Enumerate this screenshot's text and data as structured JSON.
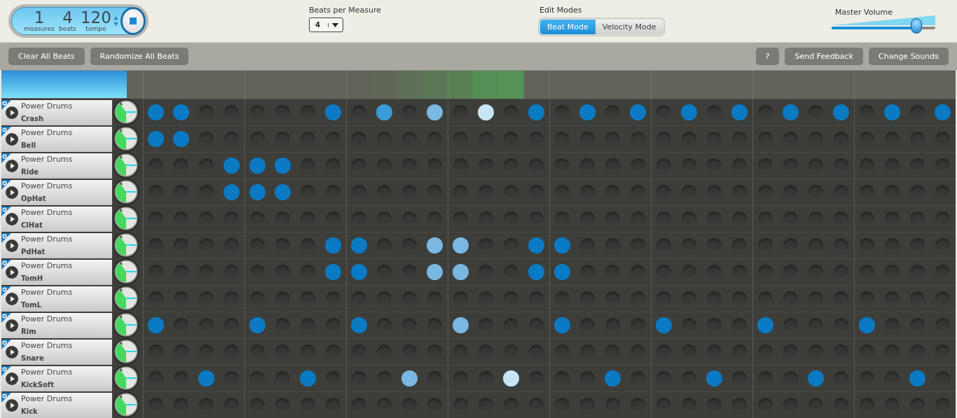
{
  "transport": {
    "measures": {
      "value": "1",
      "label": "measures"
    },
    "beats": {
      "value": "4",
      "label": "beats"
    },
    "tempo": {
      "value": "120",
      "label": "tempo"
    }
  },
  "beats_per_measure": {
    "label": "Beats per Measure",
    "value": "4"
  },
  "edit_modes": {
    "label": "Edit Modes",
    "tabs": [
      {
        "label": "Beat Mode",
        "selected": true
      },
      {
        "label": "Velocity Mode",
        "selected": false
      }
    ]
  },
  "master_volume": {
    "label": "Master Volume",
    "level": 0.82
  },
  "toolbar": {
    "left": [
      "Clear All Beats",
      "Randomize All Beats"
    ],
    "right": [
      "?",
      "Send Feedback",
      "Change Sounds"
    ]
  },
  "timeline": [
    {
      "color": "#63625b"
    },
    {
      "color": "#63625b"
    },
    {
      "color": "#63625b"
    },
    {
      "color": "#63625b"
    },
    {
      "color": "#63625b"
    },
    {
      "color": "#63625b"
    },
    {
      "color": "#63625b"
    },
    {
      "color": "#63625b"
    },
    {
      "color": "#63625b"
    },
    {
      "color": "#606759"
    },
    {
      "color": "#5d7057"
    },
    {
      "color": "#5b7856"
    },
    {
      "color": "#598055"
    },
    {
      "color": "#568f55"
    },
    {
      "color": "#559255"
    },
    {
      "color": "#63625b"
    },
    {
      "color": "#63625b"
    },
    {
      "color": "#63625b"
    },
    {
      "color": "#63625b"
    },
    {
      "color": "#63625b"
    },
    {
      "color": "#63625b"
    },
    {
      "color": "#63625b"
    },
    {
      "color": "#63625b"
    },
    {
      "color": "#63625b"
    },
    {
      "color": "#63625b"
    },
    {
      "color": "#63625b"
    },
    {
      "color": "#63625b"
    },
    {
      "color": "#63625b"
    },
    {
      "color": "#63625b"
    },
    {
      "color": "#63625b"
    },
    {
      "color": "#63625b"
    },
    {
      "color": "#63625b"
    }
  ],
  "tracks": [
    {
      "kit": "Power Drums",
      "name": "Crash",
      "steps": [
        {
          "on": true,
          "color": "#0a7ac4"
        },
        {
          "on": true,
          "color": "#0a7ac4"
        },
        {
          "on": false
        },
        {
          "on": false
        },
        {
          "on": false
        },
        {
          "on": false
        },
        {
          "on": false
        },
        {
          "on": true,
          "color": "#0a7ac4"
        },
        {
          "on": false
        },
        {
          "on": true,
          "color": "#3d9ad8"
        },
        {
          "on": false
        },
        {
          "on": true,
          "color": "#7ab8e2"
        },
        {
          "on": false
        },
        {
          "on": true,
          "color": "#c8e5f5"
        },
        {
          "on": false
        },
        {
          "on": true,
          "color": "#0a7ac4"
        },
        {
          "on": false
        },
        {
          "on": true,
          "color": "#0a7ac4"
        },
        {
          "on": false
        },
        {
          "on": true,
          "color": "#0a7ac4"
        },
        {
          "on": false
        },
        {
          "on": true,
          "color": "#0a7ac4"
        },
        {
          "on": false
        },
        {
          "on": true,
          "color": "#0a7ac4"
        },
        {
          "on": false
        },
        {
          "on": true,
          "color": "#0a7ac4"
        },
        {
          "on": false
        },
        {
          "on": true,
          "color": "#0a7ac4"
        },
        {
          "on": false
        },
        {
          "on": true,
          "color": "#0a7ac4"
        },
        {
          "on": false
        },
        {
          "on": true,
          "color": "#0a7ac4"
        }
      ]
    },
    {
      "kit": "Power Drums",
      "name": "Bell",
      "steps": [
        {
          "on": true,
          "color": "#0a7ac4"
        },
        {
          "on": true,
          "color": "#0a7ac4"
        },
        {
          "on": false
        },
        {
          "on": false
        },
        {
          "on": false
        },
        {
          "on": false
        },
        {
          "on": false
        },
        {
          "on": false
        },
        {
          "on": false
        },
        {
          "on": false
        },
        {
          "on": false
        },
        {
          "on": false
        },
        {
          "on": false
        },
        {
          "on": false
        },
        {
          "on": false
        },
        {
          "on": false
        },
        {
          "on": false
        },
        {
          "on": false
        },
        {
          "on": false
        },
        {
          "on": false
        },
        {
          "on": false
        },
        {
          "on": false
        },
        {
          "on": false
        },
        {
          "on": false
        },
        {
          "on": false
        },
        {
          "on": false
        },
        {
          "on": false
        },
        {
          "on": false
        },
        {
          "on": false
        },
        {
          "on": false
        },
        {
          "on": false
        },
        {
          "on": false
        }
      ]
    },
    {
      "kit": "Power Drums",
      "name": "Ride",
      "steps": [
        {
          "on": false
        },
        {
          "on": false
        },
        {
          "on": false
        },
        {
          "on": true,
          "color": "#0a7ac4"
        },
        {
          "on": true,
          "color": "#0a7ac4"
        },
        {
          "on": true,
          "color": "#0a7ac4"
        },
        {
          "on": false
        },
        {
          "on": false
        },
        {
          "on": false
        },
        {
          "on": false
        },
        {
          "on": false
        },
        {
          "on": false
        },
        {
          "on": false
        },
        {
          "on": false
        },
        {
          "on": false
        },
        {
          "on": false
        },
        {
          "on": false
        },
        {
          "on": false
        },
        {
          "on": false
        },
        {
          "on": false
        },
        {
          "on": false
        },
        {
          "on": false
        },
        {
          "on": false
        },
        {
          "on": false
        },
        {
          "on": false
        },
        {
          "on": false
        },
        {
          "on": false
        },
        {
          "on": false
        },
        {
          "on": false
        },
        {
          "on": false
        },
        {
          "on": false
        },
        {
          "on": false
        }
      ]
    },
    {
      "kit": "Power Drums",
      "name": "OpHat",
      "steps": [
        {
          "on": false
        },
        {
          "on": false
        },
        {
          "on": false
        },
        {
          "on": true,
          "color": "#0a7ac4"
        },
        {
          "on": true,
          "color": "#0a7ac4"
        },
        {
          "on": true,
          "color": "#0a7ac4"
        },
        {
          "on": false
        },
        {
          "on": false
        },
        {
          "on": false
        },
        {
          "on": false
        },
        {
          "on": false
        },
        {
          "on": false
        },
        {
          "on": false
        },
        {
          "on": false
        },
        {
          "on": false
        },
        {
          "on": false
        },
        {
          "on": false
        },
        {
          "on": false
        },
        {
          "on": false
        },
        {
          "on": false
        },
        {
          "on": false
        },
        {
          "on": false
        },
        {
          "on": false
        },
        {
          "on": false
        },
        {
          "on": false
        },
        {
          "on": false
        },
        {
          "on": false
        },
        {
          "on": false
        },
        {
          "on": false
        },
        {
          "on": false
        },
        {
          "on": false
        },
        {
          "on": false
        }
      ]
    },
    {
      "kit": "Power Drums",
      "name": "ClHat",
      "steps": [
        {
          "on": false
        },
        {
          "on": false
        },
        {
          "on": false
        },
        {
          "on": false
        },
        {
          "on": false
        },
        {
          "on": false
        },
        {
          "on": false
        },
        {
          "on": false
        },
        {
          "on": false
        },
        {
          "on": false
        },
        {
          "on": false
        },
        {
          "on": false
        },
        {
          "on": false
        },
        {
          "on": false
        },
        {
          "on": false
        },
        {
          "on": false
        },
        {
          "on": false
        },
        {
          "on": false
        },
        {
          "on": false
        },
        {
          "on": false
        },
        {
          "on": false
        },
        {
          "on": false
        },
        {
          "on": false
        },
        {
          "on": false
        },
        {
          "on": false
        },
        {
          "on": false
        },
        {
          "on": false
        },
        {
          "on": false
        },
        {
          "on": false
        },
        {
          "on": false
        },
        {
          "on": false
        },
        {
          "on": false
        }
      ]
    },
    {
      "kit": "Power Drums",
      "name": "PdHat",
      "steps": [
        {
          "on": false
        },
        {
          "on": false
        },
        {
          "on": false
        },
        {
          "on": false
        },
        {
          "on": false
        },
        {
          "on": false
        },
        {
          "on": false
        },
        {
          "on": true,
          "color": "#0a7ac4"
        },
        {
          "on": true,
          "color": "#0a7ac4"
        },
        {
          "on": false
        },
        {
          "on": false
        },
        {
          "on": true,
          "color": "#7ab8e2"
        },
        {
          "on": true,
          "color": "#7ab8e2"
        },
        {
          "on": false
        },
        {
          "on": false
        },
        {
          "on": true,
          "color": "#0a7ac4"
        },
        {
          "on": true,
          "color": "#0a7ac4"
        },
        {
          "on": false
        },
        {
          "on": false
        },
        {
          "on": false
        },
        {
          "on": false
        },
        {
          "on": false
        },
        {
          "on": false
        },
        {
          "on": false
        },
        {
          "on": false
        },
        {
          "on": false
        },
        {
          "on": false
        },
        {
          "on": false
        },
        {
          "on": false
        },
        {
          "on": false
        },
        {
          "on": false
        },
        {
          "on": false
        }
      ]
    },
    {
      "kit": "Power Drums",
      "name": "TomH",
      "steps": [
        {
          "on": false
        },
        {
          "on": false
        },
        {
          "on": false
        },
        {
          "on": false
        },
        {
          "on": false
        },
        {
          "on": false
        },
        {
          "on": false
        },
        {
          "on": true,
          "color": "#0a7ac4"
        },
        {
          "on": true,
          "color": "#0a7ac4"
        },
        {
          "on": false
        },
        {
          "on": false
        },
        {
          "on": true,
          "color": "#7ab8e2"
        },
        {
          "on": true,
          "color": "#7ab8e2"
        },
        {
          "on": false
        },
        {
          "on": false
        },
        {
          "on": true,
          "color": "#0a7ac4"
        },
        {
          "on": true,
          "color": "#0a7ac4"
        },
        {
          "on": false
        },
        {
          "on": false
        },
        {
          "on": false
        },
        {
          "on": false
        },
        {
          "on": false
        },
        {
          "on": false
        },
        {
          "on": false
        },
        {
          "on": false
        },
        {
          "on": false
        },
        {
          "on": false
        },
        {
          "on": false
        },
        {
          "on": false
        },
        {
          "on": false
        },
        {
          "on": false
        },
        {
          "on": false
        }
      ]
    },
    {
      "kit": "Power Drums",
      "name": "TomL",
      "steps": [
        {
          "on": false
        },
        {
          "on": false
        },
        {
          "on": false
        },
        {
          "on": false
        },
        {
          "on": false
        },
        {
          "on": false
        },
        {
          "on": false
        },
        {
          "on": false
        },
        {
          "on": false
        },
        {
          "on": false
        },
        {
          "on": false
        },
        {
          "on": false
        },
        {
          "on": false
        },
        {
          "on": false
        },
        {
          "on": false
        },
        {
          "on": false
        },
        {
          "on": false
        },
        {
          "on": false
        },
        {
          "on": false
        },
        {
          "on": false
        },
        {
          "on": false
        },
        {
          "on": false
        },
        {
          "on": false
        },
        {
          "on": false
        },
        {
          "on": false
        },
        {
          "on": false
        },
        {
          "on": false
        },
        {
          "on": false
        },
        {
          "on": false
        },
        {
          "on": false
        },
        {
          "on": false
        },
        {
          "on": false
        }
      ]
    },
    {
      "kit": "Power Drums",
      "name": "Rim",
      "steps": [
        {
          "on": true,
          "color": "#0a7ac4"
        },
        {
          "on": false
        },
        {
          "on": false
        },
        {
          "on": false
        },
        {
          "on": true,
          "color": "#0a7ac4"
        },
        {
          "on": false
        },
        {
          "on": false
        },
        {
          "on": false
        },
        {
          "on": true,
          "color": "#0a7ac4"
        },
        {
          "on": false
        },
        {
          "on": false
        },
        {
          "on": false
        },
        {
          "on": true,
          "color": "#7ab8e2"
        },
        {
          "on": false
        },
        {
          "on": false
        },
        {
          "on": false
        },
        {
          "on": true,
          "color": "#0a7ac4"
        },
        {
          "on": false
        },
        {
          "on": false
        },
        {
          "on": false
        },
        {
          "on": true,
          "color": "#0a7ac4"
        },
        {
          "on": false
        },
        {
          "on": false
        },
        {
          "on": false
        },
        {
          "on": true,
          "color": "#0a7ac4"
        },
        {
          "on": false
        },
        {
          "on": false
        },
        {
          "on": false
        },
        {
          "on": true,
          "color": "#0a7ac4"
        },
        {
          "on": false
        },
        {
          "on": false
        },
        {
          "on": false
        }
      ]
    },
    {
      "kit": "Power Drums",
      "name": "Snare",
      "steps": [
        {
          "on": false
        },
        {
          "on": false
        },
        {
          "on": false
        },
        {
          "on": false
        },
        {
          "on": false
        },
        {
          "on": false
        },
        {
          "on": false
        },
        {
          "on": false
        },
        {
          "on": false
        },
        {
          "on": false
        },
        {
          "on": false
        },
        {
          "on": false
        },
        {
          "on": false
        },
        {
          "on": false
        },
        {
          "on": false
        },
        {
          "on": false
        },
        {
          "on": false
        },
        {
          "on": false
        },
        {
          "on": false
        },
        {
          "on": false
        },
        {
          "on": false
        },
        {
          "on": false
        },
        {
          "on": false
        },
        {
          "on": false
        },
        {
          "on": false
        },
        {
          "on": false
        },
        {
          "on": false
        },
        {
          "on": false
        },
        {
          "on": false
        },
        {
          "on": false
        },
        {
          "on": false
        },
        {
          "on": false
        }
      ]
    },
    {
      "kit": "Power Drums",
      "name": "KickSoft",
      "steps": [
        {
          "on": false
        },
        {
          "on": false
        },
        {
          "on": true,
          "color": "#0a7ac4"
        },
        {
          "on": false
        },
        {
          "on": false
        },
        {
          "on": false
        },
        {
          "on": true,
          "color": "#0a7ac4"
        },
        {
          "on": false
        },
        {
          "on": false
        },
        {
          "on": false
        },
        {
          "on": true,
          "color": "#7ab8e2"
        },
        {
          "on": false
        },
        {
          "on": false
        },
        {
          "on": false
        },
        {
          "on": true,
          "color": "#c8e5f5"
        },
        {
          "on": false
        },
        {
          "on": false
        },
        {
          "on": false
        },
        {
          "on": true,
          "color": "#0a7ac4"
        },
        {
          "on": false
        },
        {
          "on": false
        },
        {
          "on": false
        },
        {
          "on": true,
          "color": "#0a7ac4"
        },
        {
          "on": false
        },
        {
          "on": false
        },
        {
          "on": false
        },
        {
          "on": true,
          "color": "#0a7ac4"
        },
        {
          "on": false
        },
        {
          "on": false
        },
        {
          "on": false
        },
        {
          "on": true,
          "color": "#0a7ac4"
        },
        {
          "on": false
        }
      ]
    },
    {
      "kit": "Power Drums",
      "name": "Kick",
      "steps": [
        {
          "on": false
        },
        {
          "on": false
        },
        {
          "on": false
        },
        {
          "on": false
        },
        {
          "on": false
        },
        {
          "on": false
        },
        {
          "on": false
        },
        {
          "on": false
        },
        {
          "on": false
        },
        {
          "on": false
        },
        {
          "on": false
        },
        {
          "on": false
        },
        {
          "on": false
        },
        {
          "on": false
        },
        {
          "on": false
        },
        {
          "on": false
        },
        {
          "on": false
        },
        {
          "on": false
        },
        {
          "on": false
        },
        {
          "on": false
        },
        {
          "on": false
        },
        {
          "on": false
        },
        {
          "on": false
        },
        {
          "on": false
        },
        {
          "on": false
        },
        {
          "on": false
        },
        {
          "on": false
        },
        {
          "on": false
        },
        {
          "on": false
        },
        {
          "on": false
        },
        {
          "on": false
        },
        {
          "on": false
        }
      ]
    }
  ]
}
